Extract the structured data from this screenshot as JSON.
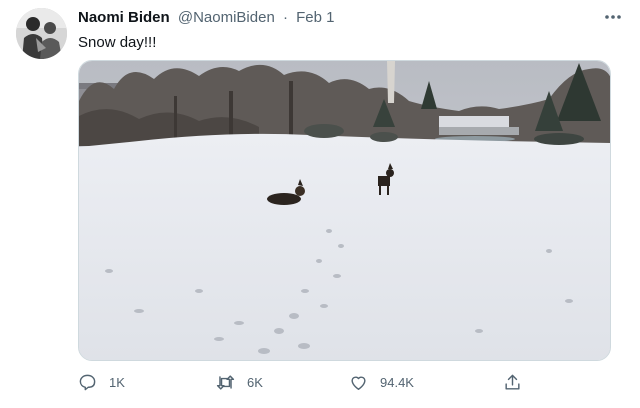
{
  "tweet": {
    "author": {
      "display_name": "Naomi Biden",
      "handle": "@NaomiBiden",
      "avatar_icon": "profile-photo"
    },
    "separator": "·",
    "date": "Feb 1",
    "text": "Snow day!!!",
    "media": {
      "kind": "photo",
      "subject": "two dogs on snowy lawn"
    },
    "actions": {
      "reply_count": "1K",
      "retweet_count": "6K",
      "like_count": "94.4K"
    }
  },
  "icons": {
    "more": "more-horizontal-icon",
    "reply": "reply-icon",
    "retweet": "retweet-icon",
    "like": "heart-icon",
    "share": "share-icon"
  },
  "colors": {
    "text_primary": "#0f1419",
    "text_secondary": "#536471",
    "border": "#cfd9de"
  }
}
